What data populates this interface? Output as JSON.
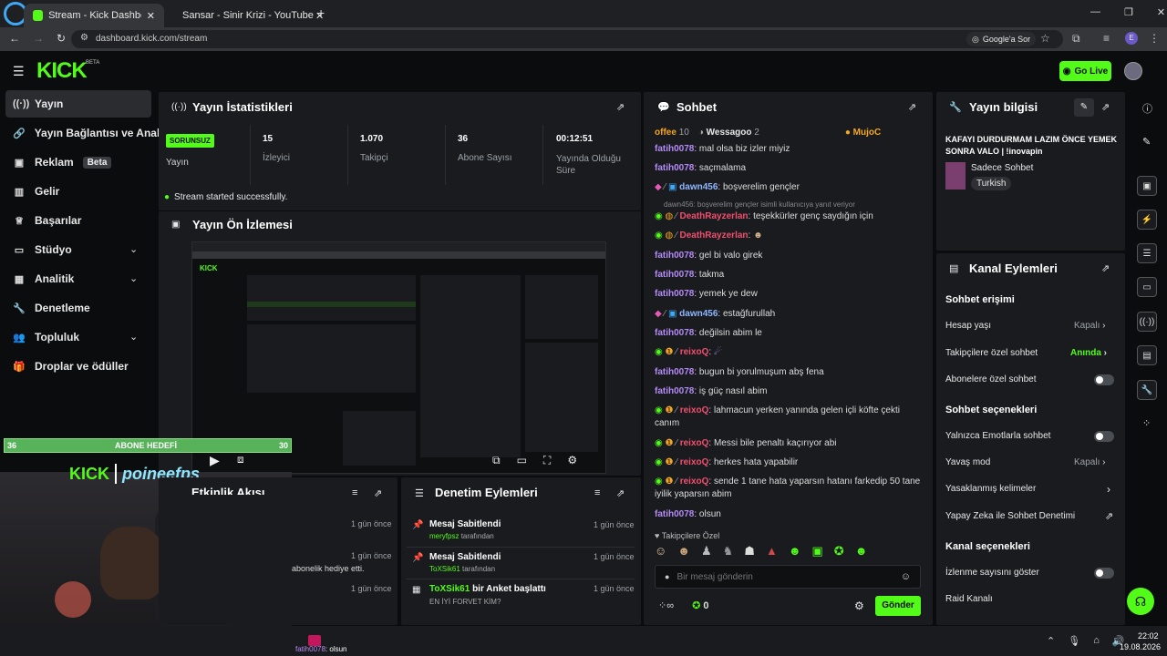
{
  "browser": {
    "tabs": [
      {
        "label": "Stream - Kick Dashboard"
      },
      {
        "label": "Sansar - Sinir Krizi - YouTube"
      }
    ],
    "url": "dashboard.kick.com/stream",
    "google_label": "Google'a Sor",
    "profile_initial": "E"
  },
  "app": {
    "logo": "KICK",
    "beta": "BETA",
    "go_live": "Go Live"
  },
  "sidebar": {
    "items": [
      {
        "label": "Yayın"
      },
      {
        "label": "Yayın Bağlantısı ve Anahtarı"
      },
      {
        "label": "Reklam",
        "badge": "Beta"
      },
      {
        "label": "Gelir"
      },
      {
        "label": "Başarılar"
      },
      {
        "label": "Stüdyo"
      },
      {
        "label": "Analitik"
      },
      {
        "label": "Denetleme"
      },
      {
        "label": "Topluluk"
      },
      {
        "label": "Droplar ve ödüller"
      }
    ]
  },
  "stats": {
    "title": "Yayın İstatistikleri",
    "status_badge": "SORUNSUZ",
    "status_label": "Yayın",
    "items": [
      {
        "value": "15",
        "label": "İzleyici"
      },
      {
        "value": "1.070",
        "label": "Takipçi"
      },
      {
        "value": "36",
        "label": "Abone Sayısı"
      },
      {
        "value": "00:12:51",
        "label": "Yayında Olduğu Süre"
      }
    ],
    "success": "Stream started successfully."
  },
  "preview": {
    "title": "Yayın Ön İzlemesi"
  },
  "overlay": {
    "goal_left": "36",
    "goal_label": "ABONE HEDEFİ",
    "goal_right": "30",
    "brand": "KICK",
    "channel": "poineefps"
  },
  "activity": {
    "title": "Etkinlik Akışı",
    "times": [
      "1 gün önce",
      "1 gün önce",
      "1 gün önce"
    ],
    "text": "abonelik hediye etti."
  },
  "moderation": {
    "title": "Denetim Eylemleri",
    "items": [
      {
        "title": "Mesaj Sabitlendi",
        "user": "meryfpsz",
        "suffix": "tarafından",
        "time": "1 gün önce"
      },
      {
        "title": "Mesaj Sabitlendi",
        "user": "ToXSik61",
        "suffix": "tarafından",
        "time": "1 gün önce"
      },
      {
        "title_user": "ToXSik61",
        "title": "bir Anket başlattı",
        "sub": "EN İYİ FORVET KİM?",
        "time": "1 gün önce"
      }
    ]
  },
  "chat": {
    "title": "Sohbet",
    "pinned": [
      {
        "name": "offee",
        "count": "10"
      },
      {
        "name": "Wessagoo",
        "count": "2"
      },
      {
        "name": "MujoC"
      }
    ],
    "messages": [
      {
        "user": "fatih0078",
        "text": "mal olsa biz izler miyiz"
      },
      {
        "user": "fatih0078",
        "text": "saçmalama"
      },
      {
        "user": "dawn456",
        "text": "boşverelim gençler"
      },
      {
        "reply": "dawn456: boşverelim gençler isimli kullanıcıya yanıt veriyor"
      },
      {
        "user": "DeathRayzerlan",
        "text": "teşekkürler genç saydığın için"
      },
      {
        "user": "DeathRayzerlan",
        "text": ""
      },
      {
        "user": "fatih0078",
        "text": "gel bi valo girek"
      },
      {
        "user": "fatih0078",
        "text": "takma"
      },
      {
        "user": "fatih0078",
        "text": "yemek ye dew"
      },
      {
        "user": "dawn456",
        "text": "estağfurullah"
      },
      {
        "user": "fatih0078",
        "text": "değilsin abim le"
      },
      {
        "user": "reixoQ",
        "text": ""
      },
      {
        "user": "fatih0078",
        "text": "bugun bi yorulmuşum abş fena"
      },
      {
        "user": "fatih0078",
        "text": "iş güç nasıl abim"
      },
      {
        "user": "reixoQ",
        "text": "lahmacun yerken yanında gelen içli köfte çekti canım"
      },
      {
        "user": "reixoQ",
        "text": "Messi bile penaltı kaçırıyor abi"
      },
      {
        "user": "reixoQ",
        "text": "herkes hata yapabilir"
      },
      {
        "user": "reixoQ",
        "text": "sende 1 tane hata yaparsın hatanı farkedip 50 tane iyilik yaparsın abim"
      },
      {
        "user": "fatih0078",
        "text": "olsun"
      }
    ],
    "followers_only": "Takipçilere Özel",
    "input_placeholder": "Bir mesaj gönderin",
    "points": "0",
    "send": "Gönder"
  },
  "stream_info": {
    "title": "Yayın bilgisi",
    "stream_title": "KAFAYI DURDURMAM LAZIM ÖNCE YEMEK SONRA VALO | !inovapin",
    "category": "Sadece Sohbet",
    "tag": "Turkish"
  },
  "channel_actions": {
    "title": "Kanal Eylemleri",
    "sections": {
      "access": "Sohbet erişimi",
      "options": "Sohbet seçenekleri",
      "channel": "Kanal seçenekleri"
    },
    "rows": {
      "account_age": "Hesap yaşı",
      "account_age_val": "Kapalı",
      "followers_chat": "Takipçilere özel sohbet",
      "followers_chat_val": "Anında",
      "subs_chat": "Abonelere özel sohbet",
      "emote_only": "Yalnızca Emotlarla sohbet",
      "slow_mode": "Yavaş mod",
      "slow_mode_val": "Kapalı",
      "banned_words": "Yasaklanmış kelimeler",
      "ai_mod": "Yapay Zeka ile Sohbet Denetimi",
      "show_viewers": "İzlenme sayısını göster",
      "raid": "Raid Kanalı"
    }
  },
  "taskbar": {
    "overlay_user": "fatih0078",
    "overlay_text": ": olsun",
    "time": "22:02",
    "date": "19.08.2026"
  }
}
